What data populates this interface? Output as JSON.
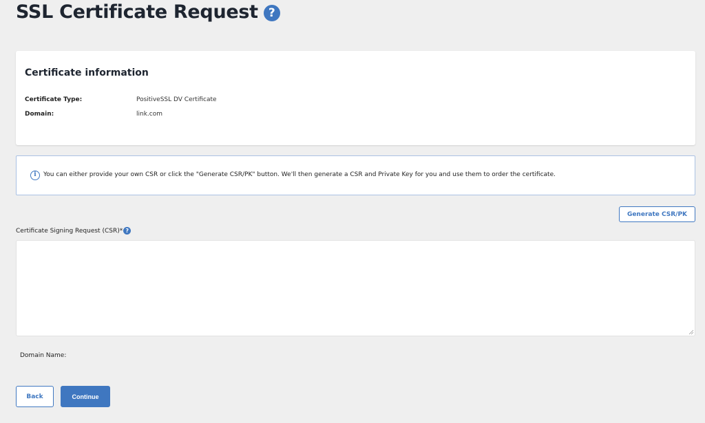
{
  "header": {
    "title": "SSL Certificate Request",
    "help_glyph": "?"
  },
  "certificate_info": {
    "title": "Certificate information",
    "rows": [
      {
        "label": "Certificate Type:",
        "value": "PositiveSSL DV Certificate"
      },
      {
        "label": "Domain:",
        "value": "link.com"
      }
    ]
  },
  "notice": {
    "icon": "info-icon",
    "icon_glyph": "i",
    "text": "You can either provide your own CSR or click the \"Generate CSR/PK\" button. We'll then generate a CSR and Private Key for you and use them to order the certificate."
  },
  "generate_button": {
    "label": "Generate CSR/PK"
  },
  "csr": {
    "label": "Certificate Signing Request (CSR)*",
    "help_glyph": "?",
    "value": "",
    "placeholder": ""
  },
  "domain_name": {
    "label": "Domain Name:"
  },
  "footer": {
    "back_label": "Back",
    "continue_label": "Continue"
  },
  "colors": {
    "accent": "#3f77c0",
    "background": "#efefef",
    "notice_border": "#a9c1e3"
  }
}
